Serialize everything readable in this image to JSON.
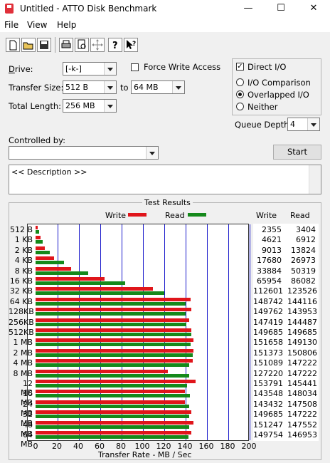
{
  "window": {
    "title": "Untitled - ATTO Disk Benchmark",
    "minimize": "—",
    "maximize": "☐",
    "close": "✕"
  },
  "menu": [
    "File",
    "View",
    "Help"
  ],
  "toolbar": [
    "new",
    "open",
    "save",
    "print",
    "print-preview",
    "move",
    "help",
    "context-help"
  ],
  "settings": {
    "drive_label": "Drive:",
    "drive_value": "[-k-]",
    "transfer_label": "Transfer Size:",
    "transfer_from": "512 B",
    "transfer_to_label": "to",
    "transfer_to": "64 MB",
    "total_length_label": "Total Length:",
    "total_length": "256 MB",
    "force_write_label": "Force Write Access",
    "direct_io_label": "Direct I/O",
    "io_comparison_label": "I/O Comparison",
    "overlapped_io_label": "Overlapped I/O",
    "neither_label": "Neither",
    "queue_depth_label": "Queue Depth:",
    "queue_depth": "4",
    "controlled_by_label": "Controlled by:",
    "controlled_by": "",
    "start_label": "Start",
    "description": "<< Description >>"
  },
  "results": {
    "title": "Test Results",
    "legend_write": "Write",
    "legend_read": "Read",
    "col_write": "Write",
    "col_read": "Read",
    "xlabel": "Transfer Rate - MB / Sec"
  },
  "colors": {
    "write": "#e0151b",
    "read": "#15891b",
    "grid": "#1a1acb"
  },
  "chart_data": {
    "type": "bar",
    "orientation": "horizontal",
    "title": "Test Results",
    "xlabel": "Transfer Rate - MB / Sec",
    "xlim": [
      0,
      200
    ],
    "xticks": [
      0,
      20,
      40,
      60,
      80,
      100,
      120,
      140,
      160,
      180,
      200
    ],
    "categories": [
      "512 B",
      "1 KB",
      "2 KB",
      "4 KB",
      "8 KB",
      "16 KB",
      "32 KB",
      "64 KB",
      "128KB",
      "256KB",
      "512KB",
      "1 MB",
      "2 MB",
      "4 MB",
      "8 MB",
      "12 MB",
      "16 MB",
      "24 MB",
      "32 MB",
      "48 MB",
      "64 MB"
    ],
    "series": [
      {
        "name": "Write",
        "display": [
          "2355",
          "4621",
          "9013",
          "17680",
          "33884",
          "65954",
          "112601",
          "148742",
          "149762",
          "147419",
          "149685",
          "151658",
          "151373",
          "151089",
          "127220",
          "153791",
          "143548",
          "143432",
          "149685",
          "151247",
          "149754"
        ]
      },
      {
        "name": "Read",
        "display": [
          "3404",
          "6912",
          "13824",
          "26973",
          "50319",
          "86082",
          "123526",
          "144116",
          "143953",
          "144487",
          "149685",
          "149130",
          "150806",
          "147222",
          "147222",
          "145441",
          "148034",
          "147508",
          "147222",
          "147552",
          "146953"
        ]
      }
    ]
  }
}
